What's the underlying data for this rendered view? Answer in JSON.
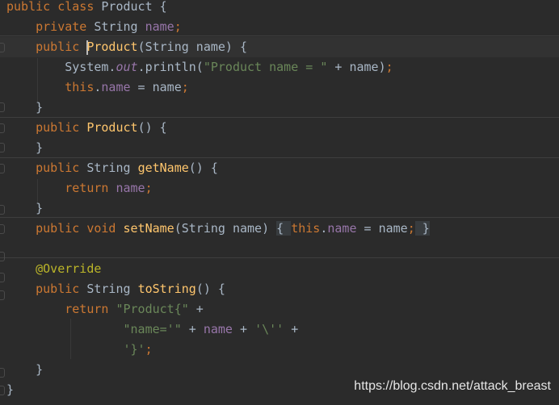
{
  "editor": {
    "colors": {
      "background": "#2b2b2b",
      "keyword": "#cc7832",
      "field": "#9876aa",
      "method": "#ffc66d",
      "string": "#6a8759",
      "annotation": "#bbb529",
      "plain": "#a9b7c6"
    },
    "lines": [
      [
        {
          "t": "kw",
          "v": "public class "
        },
        {
          "t": "txt",
          "v": "Product {"
        }
      ],
      [
        {
          "t": "kw",
          "v": "    private "
        },
        {
          "t": "txt",
          "v": "String "
        },
        {
          "t": "fld",
          "v": "name"
        },
        {
          "t": "kw",
          "v": ";"
        }
      ],
      [
        {
          "t": "kw",
          "v": "    public "
        },
        {
          "t": "caret",
          "v": ""
        },
        {
          "t": "fn",
          "v": "Product"
        },
        {
          "t": "txt",
          "v": "(String name) {"
        }
      ],
      [
        {
          "t": "txt",
          "v": "        System."
        },
        {
          "t": "fldi",
          "v": "out"
        },
        {
          "t": "txt",
          "v": ".println("
        },
        {
          "t": "str",
          "v": "\"Product name = \""
        },
        {
          "t": "txt",
          "v": " + name)"
        },
        {
          "t": "kw",
          "v": ";"
        }
      ],
      [
        {
          "t": "kw",
          "v": "        this"
        },
        {
          "t": "txt",
          "v": "."
        },
        {
          "t": "fld",
          "v": "name"
        },
        {
          "t": "txt",
          "v": " = name"
        },
        {
          "t": "kw",
          "v": ";"
        }
      ],
      [
        {
          "t": "txt",
          "v": "    }"
        }
      ],
      [
        {
          "t": "kw",
          "v": "    public "
        },
        {
          "t": "fn",
          "v": "Product"
        },
        {
          "t": "txt",
          "v": "() {"
        }
      ],
      [
        {
          "t": "txt",
          "v": "    }"
        }
      ],
      [
        {
          "t": "kw",
          "v": "    public "
        },
        {
          "t": "txt",
          "v": "String "
        },
        {
          "t": "fn",
          "v": "getName"
        },
        {
          "t": "txt",
          "v": "() {"
        }
      ],
      [
        {
          "t": "kw",
          "v": "        return "
        },
        {
          "t": "fld",
          "v": "name"
        },
        {
          "t": "kw",
          "v": ";"
        }
      ],
      [
        {
          "t": "txt",
          "v": "    }"
        }
      ],
      [
        {
          "t": "kw",
          "v": "    public void "
        },
        {
          "t": "fn",
          "v": "setName"
        },
        {
          "t": "txt",
          "v": "(String name) "
        },
        {
          "t": "fold",
          "v": "{ "
        },
        {
          "t": "kw",
          "v": "this"
        },
        {
          "t": "txt",
          "v": "."
        },
        {
          "t": "fld",
          "v": "name"
        },
        {
          "t": "txt",
          "v": " = name"
        },
        {
          "t": "kw",
          "v": ";"
        },
        {
          "t": "fold",
          "v": " }"
        }
      ],
      [
        {
          "t": "txt",
          "v": ""
        }
      ],
      [
        {
          "t": "ann",
          "v": "    @Override"
        }
      ],
      [
        {
          "t": "kw",
          "v": "    public "
        },
        {
          "t": "txt",
          "v": "String "
        },
        {
          "t": "fn",
          "v": "toString"
        },
        {
          "t": "txt",
          "v": "() {"
        }
      ],
      [
        {
          "t": "kw",
          "v": "        return "
        },
        {
          "t": "str",
          "v": "\"Product{\""
        },
        {
          "t": "txt",
          "v": " +"
        }
      ],
      [
        {
          "t": "str",
          "v": "                \"name='\""
        },
        {
          "t": "txt",
          "v": " + "
        },
        {
          "t": "fld",
          "v": "name"
        },
        {
          "t": "txt",
          "v": " + "
        },
        {
          "t": "str",
          "v": "'\\''"
        },
        {
          "t": "txt",
          "v": " +"
        }
      ],
      [
        {
          "t": "str",
          "v": "                '}'"
        },
        {
          "t": "kw",
          "v": ";"
        }
      ],
      [
        {
          "t": "txt",
          "v": "    }"
        }
      ],
      [
        {
          "t": "txt",
          "v": "}"
        }
      ]
    ]
  },
  "watermark": "https://blog.csdn.net/attack_breast"
}
